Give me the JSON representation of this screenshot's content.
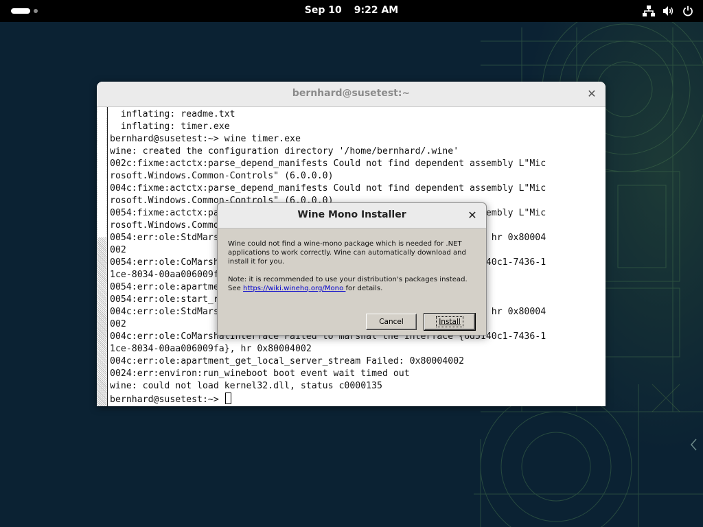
{
  "topbar": {
    "date": "Sep 10",
    "time": "9:22 AM",
    "icons": [
      "activities-indicator",
      "network-wired-icon",
      "volume-icon",
      "power-icon"
    ]
  },
  "terminal": {
    "title": "bernhard@susetest:~",
    "lines": [
      "  inflating: readme.txt",
      "  inflating: timer.exe",
      "bernhard@susetest:~> wine timer.exe",
      "wine: created the configuration directory '/home/bernhard/.wine'",
      "002c:fixme:actctx:parse_depend_manifests Could not find dependent assembly L\"Mic",
      "rosoft.Windows.Common-Controls\" (6.0.0.0)",
      "004c:fixme:actctx:parse_depend_manifests Could not find dependent assembly L\"Mic",
      "rosoft.Windows.Common-Controls\" (6.0.0.0)",
      "0054:fixme:actctx:parse_depend_manifests Could not find dependent assembly L\"Mic",
      "rosoft.Windows.Common-Controls\" (6.0.0.0)",
      "0054:err:ole:StdMarshalImpl_MarshalInterface Failed to create ifstub, hr 0x80004",
      "002",
      "0054:err:ole:CoMarshalInterface Failed to marshal the interface {6d5140c1-7436-1",
      "1ce-8034-00aa006009fa}, hr 0x80004002",
      "0054:err:ole:apartment_get_local_server_stream Failed: 0x80004002",
      "0054:err:ole:start_rpcss Failed to open RpcSs service",
      "004c:err:ole:StdMarshalImpl_MarshalInterface Failed to create ifstub, hr 0x80004",
      "002",
      "004c:err:ole:CoMarshalInterface Failed to marshal the interface {6d5140c1-7436-1",
      "1ce-8034-00aa006009fa}, hr 0x80004002",
      "004c:err:ole:apartment_get_local_server_stream Failed: 0x80004002",
      "0024:err:environ:run_wineboot boot event wait timed out",
      "wine: could not load kernel32.dll, status c0000135",
      "bernhard@susetest:~> "
    ]
  },
  "dialog": {
    "title": "Wine Mono Installer",
    "message_line1": "Wine could not find a wine-mono package which is needed for .NET",
    "message_line2": "applications to work correctly. Wine can automatically download and",
    "message_line3": "install it for you.",
    "note_line1": "Note: it is recommended to use your distribution's packages instead.",
    "note_see": "See ",
    "note_link": "https://wiki.winehq.org/Mono ",
    "note_end": " for details.",
    "cancel_label": "Cancel",
    "install_label": "Install"
  },
  "colors": {
    "desktop": "#0b2233",
    "topbar": "#000000",
    "dialog_bg": "#d4d0c8",
    "link": "#0000cc"
  }
}
